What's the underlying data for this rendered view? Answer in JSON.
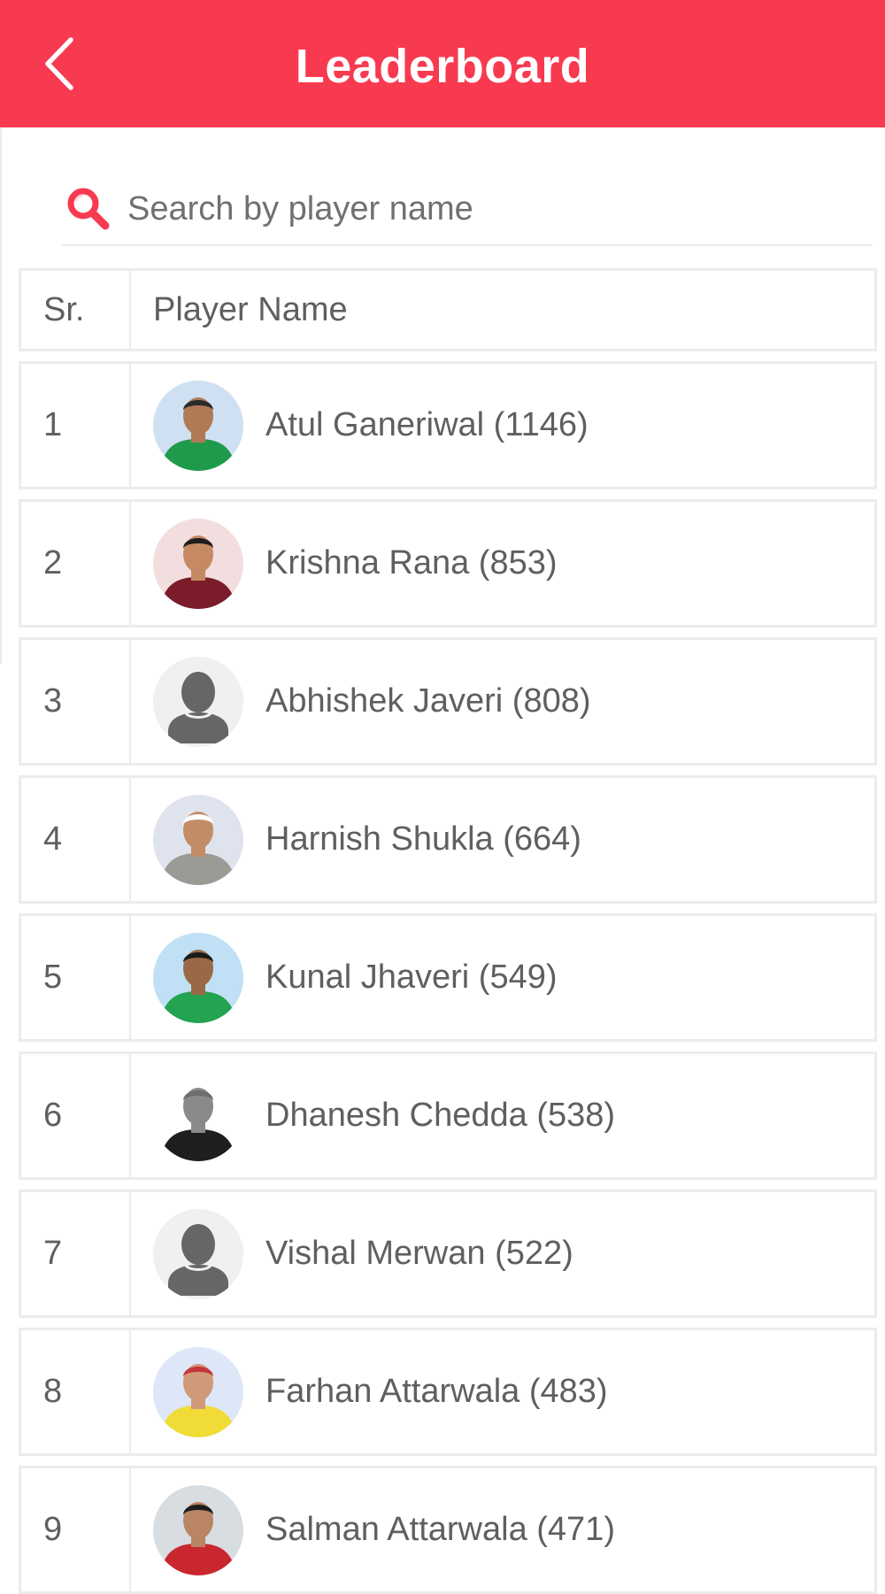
{
  "header": {
    "title": "Leaderboard",
    "accent": "#f73a50"
  },
  "search": {
    "placeholder": "Search by player name",
    "value": ""
  },
  "table": {
    "columns": [
      "Sr.",
      "Player Name"
    ],
    "rows": [
      {
        "sr": "1",
        "name": "Atul Ganeriwal (1146)",
        "avatar": "photo"
      },
      {
        "sr": "2",
        "name": "Krishna Rana (853)",
        "avatar": "photo"
      },
      {
        "sr": "3",
        "name": "Abhishek Javeri (808)",
        "avatar": "placeholder"
      },
      {
        "sr": "4",
        "name": "Harnish Shukla (664)",
        "avatar": "photo"
      },
      {
        "sr": "5",
        "name": "Kunal Jhaveri (549)",
        "avatar": "photo"
      },
      {
        "sr": "6",
        "name": "Dhanesh Chedda (538)",
        "avatar": "photo"
      },
      {
        "sr": "7",
        "name": "Vishal Merwan (522)",
        "avatar": "placeholder"
      },
      {
        "sr": "8",
        "name": "Farhan Attarwala (483)",
        "avatar": "photo"
      },
      {
        "sr": "9",
        "name": "Salman Attarwala (471)",
        "avatar": "photo"
      }
    ]
  }
}
